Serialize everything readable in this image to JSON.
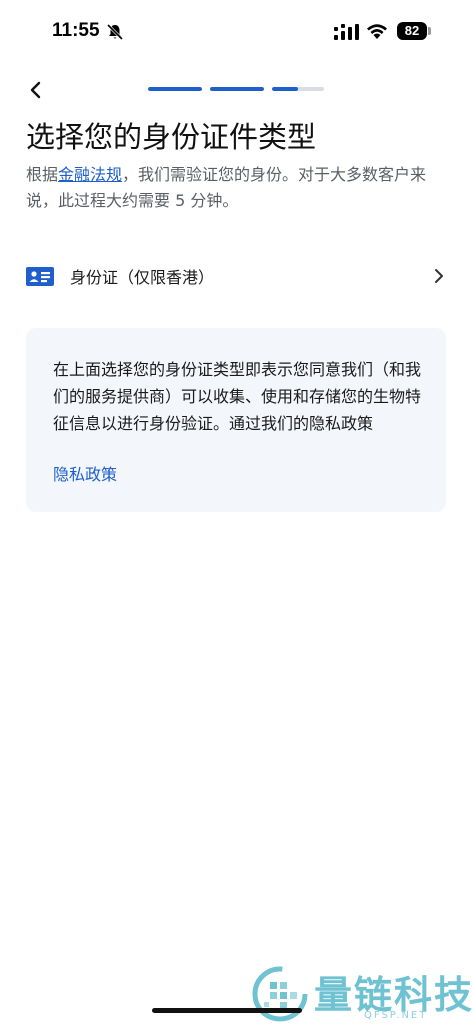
{
  "status_bar": {
    "time": "11:55",
    "battery": "82"
  },
  "progress": {
    "steps": [
      {
        "fill": 1.0
      },
      {
        "fill": 1.0
      },
      {
        "fill": 0.5
      }
    ]
  },
  "header": {
    "title": "选择您的身份证件类型"
  },
  "subtitle": {
    "prefix": "根据",
    "link": "金融法规",
    "suffix": "，我们需验证您的身份。对于大多数客户来说，此过程大约需要 5 分钟。"
  },
  "id_option": {
    "label": "身份证（仅限香港）"
  },
  "notice": {
    "text": "在上面选择您的身份证类型即表示您同意我们（和我们的服务提供商）可以收集、使用和存储您的生物特征信息以进行身份验证。通过我们的隐私政策",
    "link": "隐私政策"
  },
  "watermark": {
    "text": "量链科技",
    "sub": "QFSP.NET"
  },
  "colors": {
    "accent": "#1e5fcc",
    "notice_bg": "#f3f6fb",
    "track": "#d9dde3"
  }
}
